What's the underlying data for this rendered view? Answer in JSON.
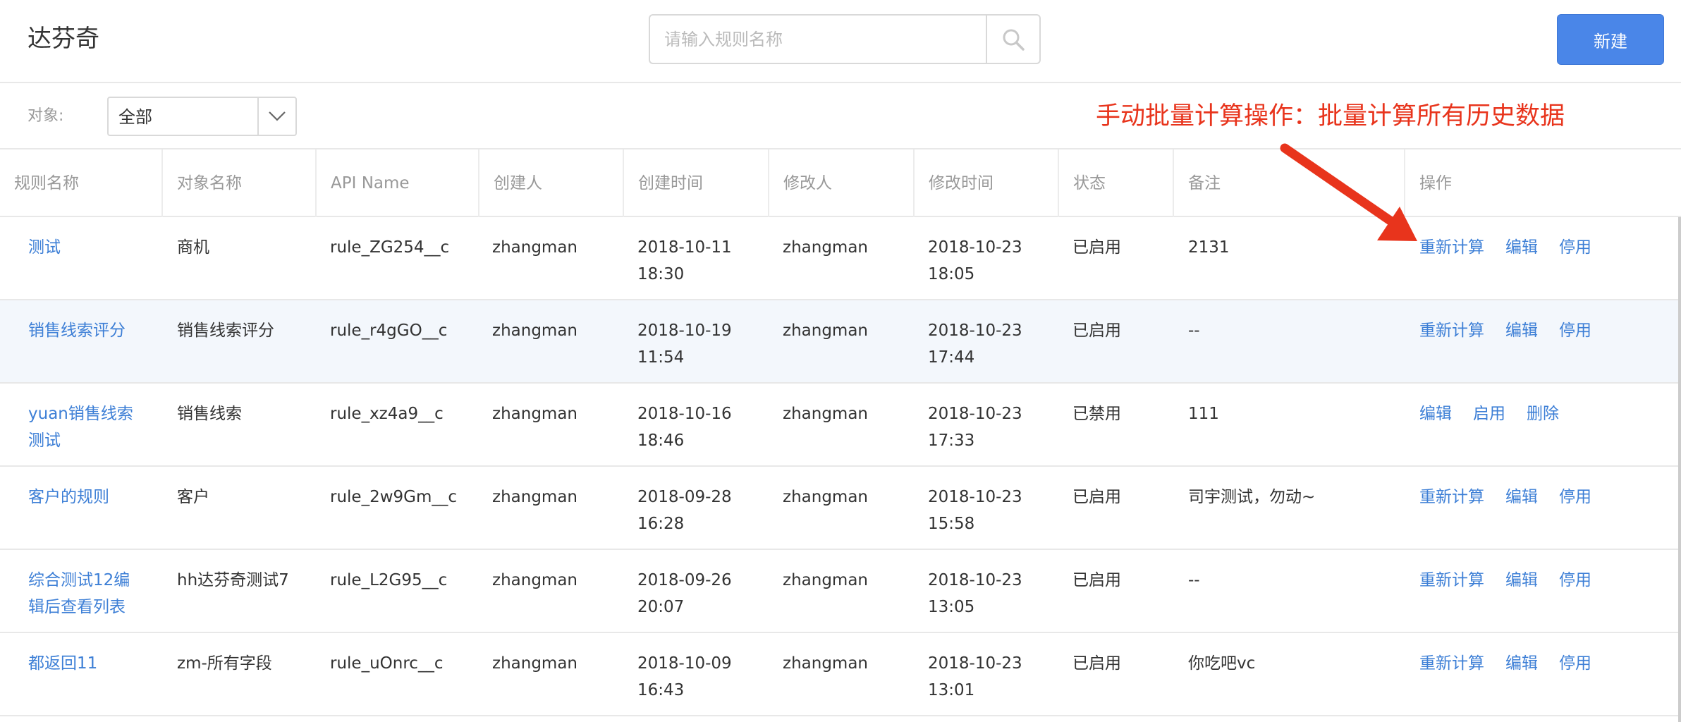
{
  "header": {
    "app_title": "达芬奇",
    "search_placeholder": "请输入规则名称",
    "new_button": "新建"
  },
  "filter": {
    "label": "对象:",
    "selected": "全部"
  },
  "annotation": "手动批量计算操作：批量计算所有历史数据",
  "table": {
    "columns": [
      "规则名称",
      "对象名称",
      "API Name",
      "创建人",
      "创建时间",
      "修改人",
      "修改时间",
      "状态",
      "备注",
      "操作"
    ],
    "rows": [
      {
        "name": [
          "测试",
          ""
        ],
        "object": "商机",
        "api": "rule_ZG254__c",
        "creator": "zhangman",
        "created": [
          "2018-10-11",
          "18:30"
        ],
        "modifier": "zhangman",
        "modified": [
          "2018-10-23",
          "18:05"
        ],
        "status": "已启用",
        "note": "2131",
        "ops": [
          "重新计算",
          "编辑",
          "停用"
        ]
      },
      {
        "name": [
          "销售线索评分",
          ""
        ],
        "object": "销售线索评分",
        "api": "rule_r4gGO__c",
        "creator": "zhangman",
        "created": [
          "2018-10-19",
          "11:54"
        ],
        "modifier": "zhangman",
        "modified": [
          "2018-10-23",
          "17:44"
        ],
        "status": "已启用",
        "note": "--",
        "ops": [
          "重新计算",
          "编辑",
          "停用"
        ]
      },
      {
        "name": [
          "yuan销售线索",
          "测试"
        ],
        "object": "销售线索",
        "api": "rule_xz4a9__c",
        "creator": "zhangman",
        "created": [
          "2018-10-16",
          "18:46"
        ],
        "modifier": "zhangman",
        "modified": [
          "2018-10-23",
          "17:33"
        ],
        "status": "已禁用",
        "note": "111",
        "ops": [
          "编辑",
          "启用",
          "删除"
        ]
      },
      {
        "name": [
          "客户的规则",
          ""
        ],
        "object": "客户",
        "api": "rule_2w9Gm__c",
        "creator": "zhangman",
        "created": [
          "2018-09-28",
          "16:28"
        ],
        "modifier": "zhangman",
        "modified": [
          "2018-10-23",
          "15:58"
        ],
        "status": "已启用",
        "note": "司宇测试，勿动~",
        "ops": [
          "重新计算",
          "编辑",
          "停用"
        ]
      },
      {
        "name": [
          "综合测试12编",
          "辑后查看列表"
        ],
        "object": "hh达芬奇测试7",
        "api": "rule_L2G95__c",
        "creator": "zhangman",
        "created": [
          "2018-09-26",
          "20:07"
        ],
        "modifier": "zhangman",
        "modified": [
          "2018-10-23",
          "13:05"
        ],
        "status": "已启用",
        "note": "--",
        "ops": [
          "重新计算",
          "编辑",
          "停用"
        ]
      },
      {
        "name": [
          "都返回11",
          ""
        ],
        "object": "zm-所有字段",
        "api": "rule_uOnrc__c",
        "creator": "zhangman",
        "created": [
          "2018-10-09",
          "16:43"
        ],
        "modifier": "zhangman",
        "modified": [
          "2018-10-23",
          "13:01"
        ],
        "status": "已启用",
        "note": "你吃吧vc",
        "ops": [
          "重新计算",
          "编辑",
          "停用"
        ]
      }
    ]
  },
  "colors": {
    "accent": "#4a86e8",
    "link": "#3d7fd6",
    "annotation": "#e8341c",
    "row_highlight": "#f3f7fc"
  },
  "icons": {
    "search": "search-icon",
    "dropdown": "chevron-down-icon",
    "annotation_arrow": "arrow-icon"
  }
}
